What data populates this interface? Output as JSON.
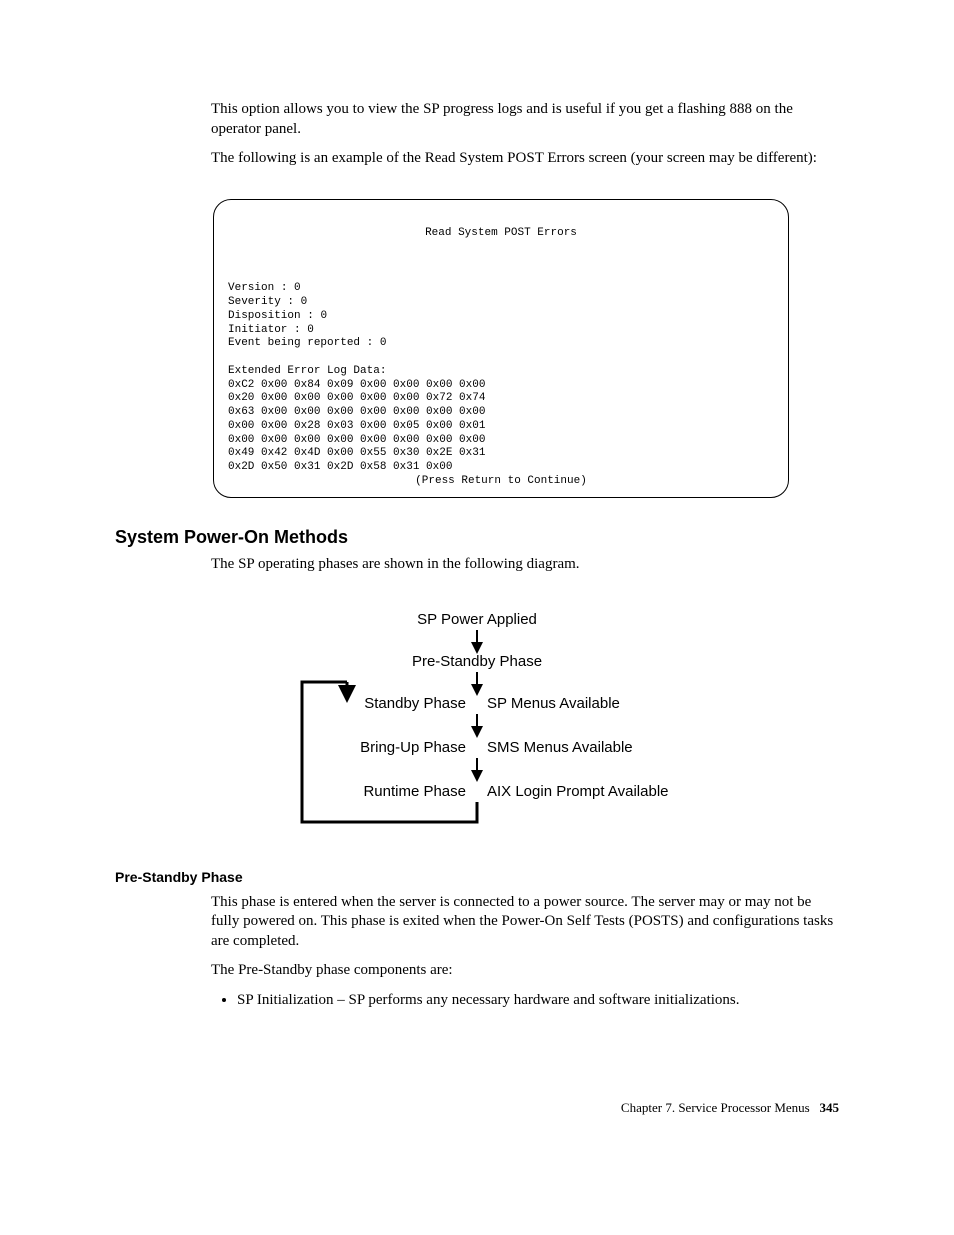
{
  "intro1": "This option allows you to view the SP progress logs and is useful if you get a flashing 888 on the operator panel.",
  "intro2": "The following is an example of the Read System POST Errors screen (your screen may be different):",
  "terminal": {
    "title": "Read System POST Errors",
    "label_version": "Version",
    "val_version": "0",
    "label_severity": "Severity",
    "val_severity": "0",
    "label_disposition": "Disposition",
    "val_disposition": "0",
    "label_initiator": "Initiator",
    "val_initiator": "0",
    "label_event": "Event being reported",
    "val_event": "0",
    "log_heading": "Extended Error Log Data:",
    "log_rows": [
      "0xC2 0x00 0x84 0x09 0x00 0x00 0x00 0x00",
      "0x20 0x00 0x00 0x00 0x00 0x00 0x72 0x74",
      "0x63 0x00 0x00 0x00 0x00 0x00 0x00 0x00",
      "0x00 0x00 0x28 0x03 0x00 0x05 0x00 0x01",
      "0x00 0x00 0x00 0x00 0x00 0x00 0x00 0x00",
      "0x49 0x42 0x4D 0x00 0x55 0x30 0x2E 0x31",
      "0x2D 0x50 0x31 0x2D 0x58 0x31 0x00"
    ],
    "continue": "(Press Return to Continue)"
  },
  "section_title": "System Power-On Methods",
  "phases_para_lead": "The SP operating phases are shown in the following diagram.",
  "phases": {
    "p1": "SP Power Applied",
    "p2": "Pre-Standby Phase",
    "p3_left": "Standby Phase",
    "p3_right": "SP Menus Available",
    "p4_left": "Bring-Up Phase",
    "p4_right": "SMS Menus Available",
    "p5_left": "Runtime Phase",
    "p5_right": "AIX Login Prompt  Available"
  },
  "pre_standby_title": "Pre-Standby Phase",
  "pre_standby_p1": "This phase is entered when the server is connected to a power source. The server may or may not be fully powered on. This phase is exited when the Power-On Self Tests (POSTS) and configurations tasks are completed.",
  "pre_standby_p2": "The Pre-Standby phase components are:",
  "bullet1": "SP Initialization – SP performs any necessary hardware and software initializations.",
  "footer_chapter": "Chapter 7.",
  "footer_title": "Service Processor Menus",
  "footer_page": "345"
}
